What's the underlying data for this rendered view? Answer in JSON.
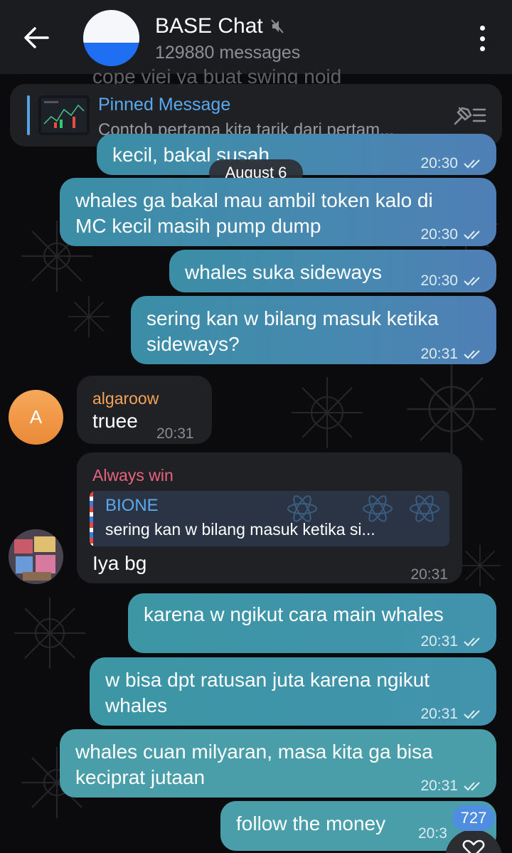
{
  "header": {
    "title": "BASE Chat",
    "subtitle": "129880 messages",
    "muted_icon": "muted-speaker-icon",
    "back_icon": "back-arrow-icon",
    "menu_icon": "more-vertical-icon"
  },
  "ghost_text": "cope viei ya buat swing noid",
  "pinned": {
    "title": "Pinned Message",
    "text": "Contoh pertama kita tarik dari pertam...",
    "icon": "unpin-list-icon"
  },
  "date_chip": "August 6",
  "messages": [
    {
      "type": "out",
      "text": "kecil, bakal susah",
      "time": "20:30"
    },
    {
      "type": "out",
      "text": "whales ga bakal mau ambil token kalo di\nMC kecil masih pump dump",
      "time": "20:30"
    },
    {
      "type": "out",
      "text": "whales suka sideways",
      "time": "20:30"
    },
    {
      "type": "out",
      "text": "sering kan w bilang masuk ketika\nsideways?",
      "time": "20:31"
    },
    {
      "type": "in",
      "sender": "algaroow",
      "avatar_letter": "A",
      "text": "truee",
      "time": "20:31"
    },
    {
      "type": "in",
      "sender": "Always win",
      "reply_name": "BIONE",
      "reply_text": "sering kan w bilang masuk ketika si...",
      "text": "Iya bg",
      "time": "20:31"
    },
    {
      "type": "out",
      "text": "karena w ngikut cara main whales",
      "time": "20:31"
    },
    {
      "type": "out",
      "text": "w bisa dpt ratusan juta karena ngikut\nwhales",
      "time": "20:31"
    },
    {
      "type": "out",
      "text": "whales cuan milyaran, masa kita ga bisa\nkeciprat jutaan",
      "time": "20:31"
    },
    {
      "type": "out",
      "text": "follow the money",
      "time": "20:3"
    }
  ],
  "unread_count": "727",
  "colors": {
    "accent": "#5aa9ef",
    "sender_algaroow": "#f3a45a",
    "sender_alwayswin": "#e8637f"
  }
}
